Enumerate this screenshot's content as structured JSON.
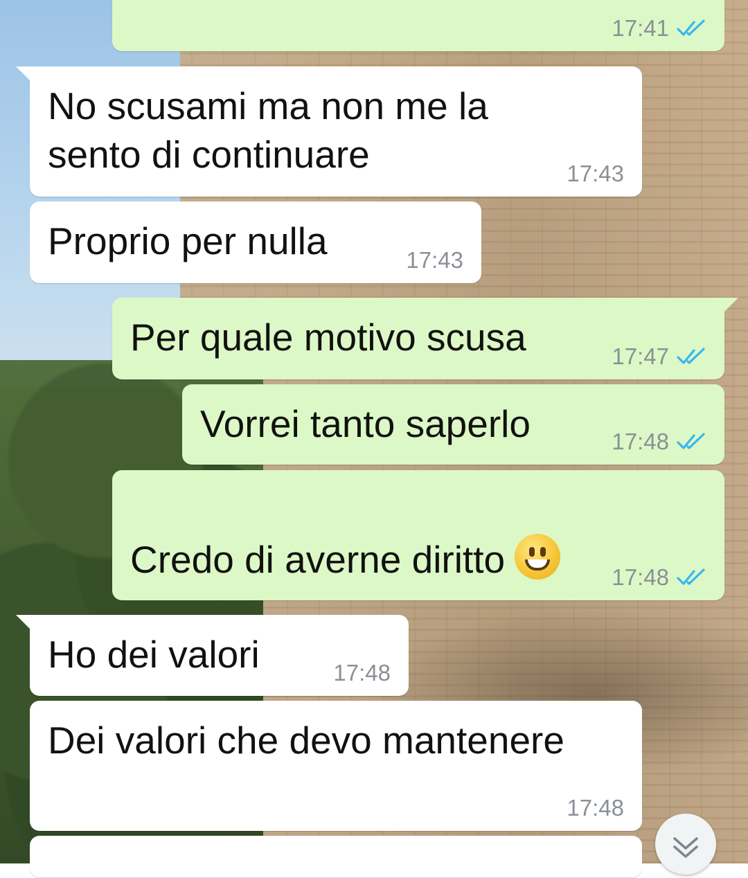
{
  "colors": {
    "incoming_bubble": "#ffffff",
    "outgoing_bubble": "#dcf8c6",
    "timestamp": "#8a9096",
    "read_ticks": "#34b7f1"
  },
  "messages": [
    {
      "direction": "out",
      "text": "",
      "time": "17:41",
      "status": "read"
    },
    {
      "direction": "in",
      "text": "No scusami ma non me la\nsento di continuare",
      "time": "17:43"
    },
    {
      "direction": "in",
      "text": "Proprio per nulla",
      "time": "17:43"
    },
    {
      "direction": "out",
      "text": "Per quale motivo scusa",
      "time": "17:47",
      "status": "read"
    },
    {
      "direction": "out",
      "text": "Vorrei tanto saperlo",
      "time": "17:48",
      "status": "read"
    },
    {
      "direction": "out",
      "text": "Credo di averne diritto",
      "emoji": "grinning-face",
      "time": "17:48",
      "status": "read"
    },
    {
      "direction": "in",
      "text": "Ho dei valori",
      "time": "17:48"
    },
    {
      "direction": "in",
      "text": "Dei valori che devo mantenere",
      "time": "17:48"
    },
    {
      "direction": "in",
      "text": "",
      "time": ""
    }
  ],
  "scroll_button_icon": "double-chevron-down-icon"
}
